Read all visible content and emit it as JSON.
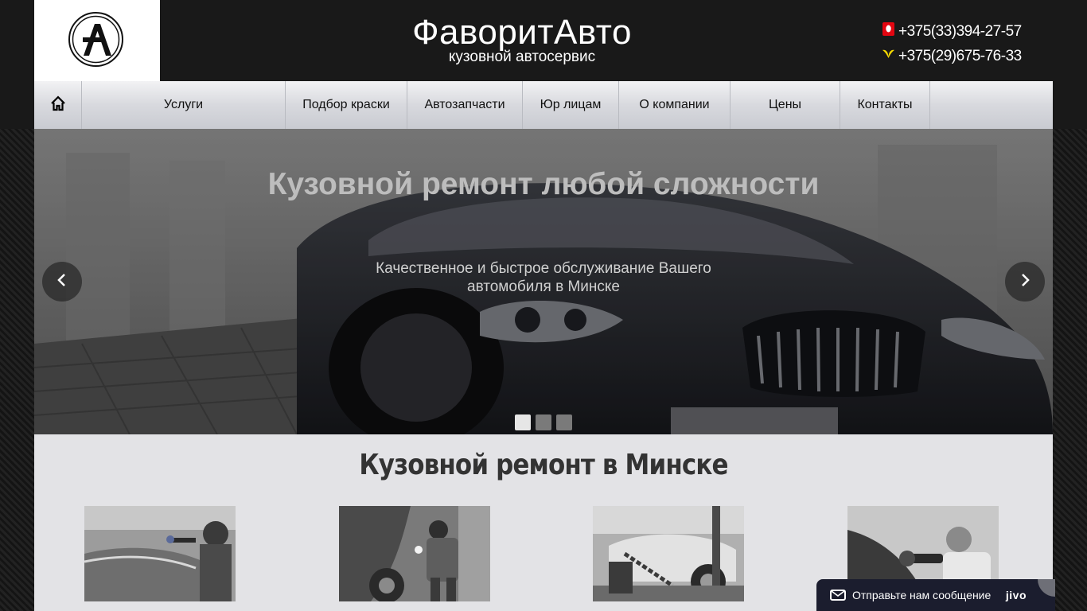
{
  "header": {
    "brand_title": "ФаворитАвто",
    "brand_subtitle": "кузовной автосервис",
    "phones": [
      {
        "operator_icon": "mts-operator-icon",
        "number": "+375(33)394-27-57"
      },
      {
        "operator_icon": "velcom-operator-icon",
        "number": "+375(29)675-76-33"
      }
    ]
  },
  "nav": {
    "home_icon": "home-icon",
    "items": [
      "Услуги",
      "Подбор краски",
      "Автозапчасти",
      "Юр лицам",
      "О компании",
      "Цены",
      "Контакты"
    ]
  },
  "slider": {
    "title": "Кузовной ремонт любой сложности",
    "description": "Качественное и быстрое обслуживание Вашего автомобиля в Минске",
    "active_slide": 1,
    "slide_count": 3
  },
  "section": {
    "title": "Кузовной ремонт в Минске"
  },
  "chat_widget": {
    "label": "Отправьте нам сообщение",
    "brand": "jivo"
  },
  "colors": {
    "header_bg": "#191919",
    "content_bg": "#e3e3e6",
    "chat_bg": "#1b1d2e"
  }
}
